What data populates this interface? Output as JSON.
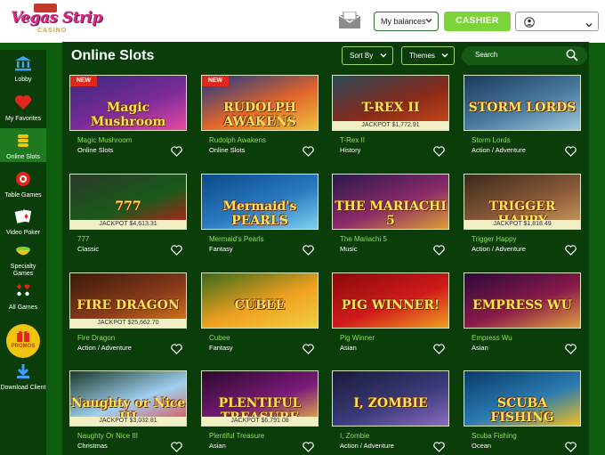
{
  "header": {
    "logo_line1": "Vegas Strip",
    "logo_line2": "CASINO",
    "mail_icon": "envelope-icon",
    "balances_label": "My balances",
    "cashier_label": "CASHIER",
    "account_icon": "user-icon"
  },
  "sidebar": {
    "items": [
      {
        "label": "Lobby",
        "icon": "bank-icon"
      },
      {
        "label": "My Favorites",
        "icon": "heart-icon"
      },
      {
        "label": "Online Slots",
        "icon": "coins-icon",
        "active": true
      },
      {
        "label": "Table Games",
        "icon": "chip-icon"
      },
      {
        "label": "Video Poker",
        "icon": "cards-icon"
      },
      {
        "label": "Specialty Games",
        "icon": "bowl-icon"
      },
      {
        "label": "All Games",
        "icon": "suits-icon"
      },
      {
        "label": "PROMOS",
        "icon": "gift-icon"
      },
      {
        "label": "Download Client",
        "icon": "download-icon"
      }
    ]
  },
  "main": {
    "title": "Online Slots",
    "sort_label": "Sort By",
    "themes_label": "Themes",
    "search_placeholder": "Search"
  },
  "games": [
    {
      "name": "Magic Mushroom",
      "category": "Online Slots",
      "badge": "NEW",
      "jackpot": "",
      "art": "Magic Mushroom"
    },
    {
      "name": "Rudolph Awakens",
      "category": "Online Slots",
      "badge": "NEW",
      "jackpot": "",
      "art": "RUDOLPH AWAKENS"
    },
    {
      "name": "T-Rex II",
      "category": "History",
      "badge": "",
      "jackpot": "JACKPOT $1,772.91",
      "art": "T-REX II"
    },
    {
      "name": "Storm Lords",
      "category": "Action / Adventure",
      "badge": "",
      "jackpot": "",
      "art": "STORM LORDS"
    },
    {
      "name": "777",
      "category": "Classic",
      "badge": "",
      "jackpot": "JACKPOT $4,613.31",
      "art": "777"
    },
    {
      "name": "Mermaid's Pearls",
      "category": "Fantasy",
      "badge": "",
      "jackpot": "",
      "art": "Mermaid's PEARLS"
    },
    {
      "name": "The Mariachi 5",
      "category": "Music",
      "badge": "",
      "jackpot": "",
      "art": "THE MARIACHI 5"
    },
    {
      "name": "Trigger Happy",
      "category": "Action / Adventure",
      "badge": "",
      "jackpot": "JACKPOT $1,818.49",
      "art": "TRIGGER HAPPY"
    },
    {
      "name": "Fire Dragon",
      "category": "Action / Adventure",
      "badge": "",
      "jackpot": "JACKPOT $25,662.70",
      "art": "FIRE DRAGON"
    },
    {
      "name": "Cubee",
      "category": "Fantasy",
      "badge": "",
      "jackpot": "",
      "art": "CUBEE"
    },
    {
      "name": "Pig Winner",
      "category": "Asian",
      "badge": "",
      "jackpot": "",
      "art": "PIG WINNER!"
    },
    {
      "name": "Empress Wu",
      "category": "Asian",
      "badge": "",
      "jackpot": "",
      "art": "EMPRESS WU"
    },
    {
      "name": "Naughty Or Nice III",
      "category": "Christmas",
      "badge": "",
      "jackpot": "JACKPOT $3,032.81",
      "art": "Naughty or Nice III"
    },
    {
      "name": "Plentiful Treasure",
      "category": "Asian",
      "badge": "",
      "jackpot": "JACKPOT $6,791.08",
      "art": "PLENTIFUL TREASURE"
    },
    {
      "name": "I, Zombie",
      "category": "Action / Adventure",
      "badge": "",
      "jackpot": "",
      "art": "I, ZOMBIE"
    },
    {
      "name": "Scuba Fishing",
      "category": "Ocean",
      "badge": "",
      "jackpot": "",
      "art": "SCUBA FISHING"
    }
  ],
  "colors": {
    "page_bg": "#0f5e0f",
    "panel_bg": "#0a3d0a",
    "accent_green": "#7dd33a",
    "game_name": "#8ee05a",
    "new_badge": "#e3261c",
    "jackpot_bg": "#f2efc4",
    "promos_badge": "#f1c40f"
  }
}
